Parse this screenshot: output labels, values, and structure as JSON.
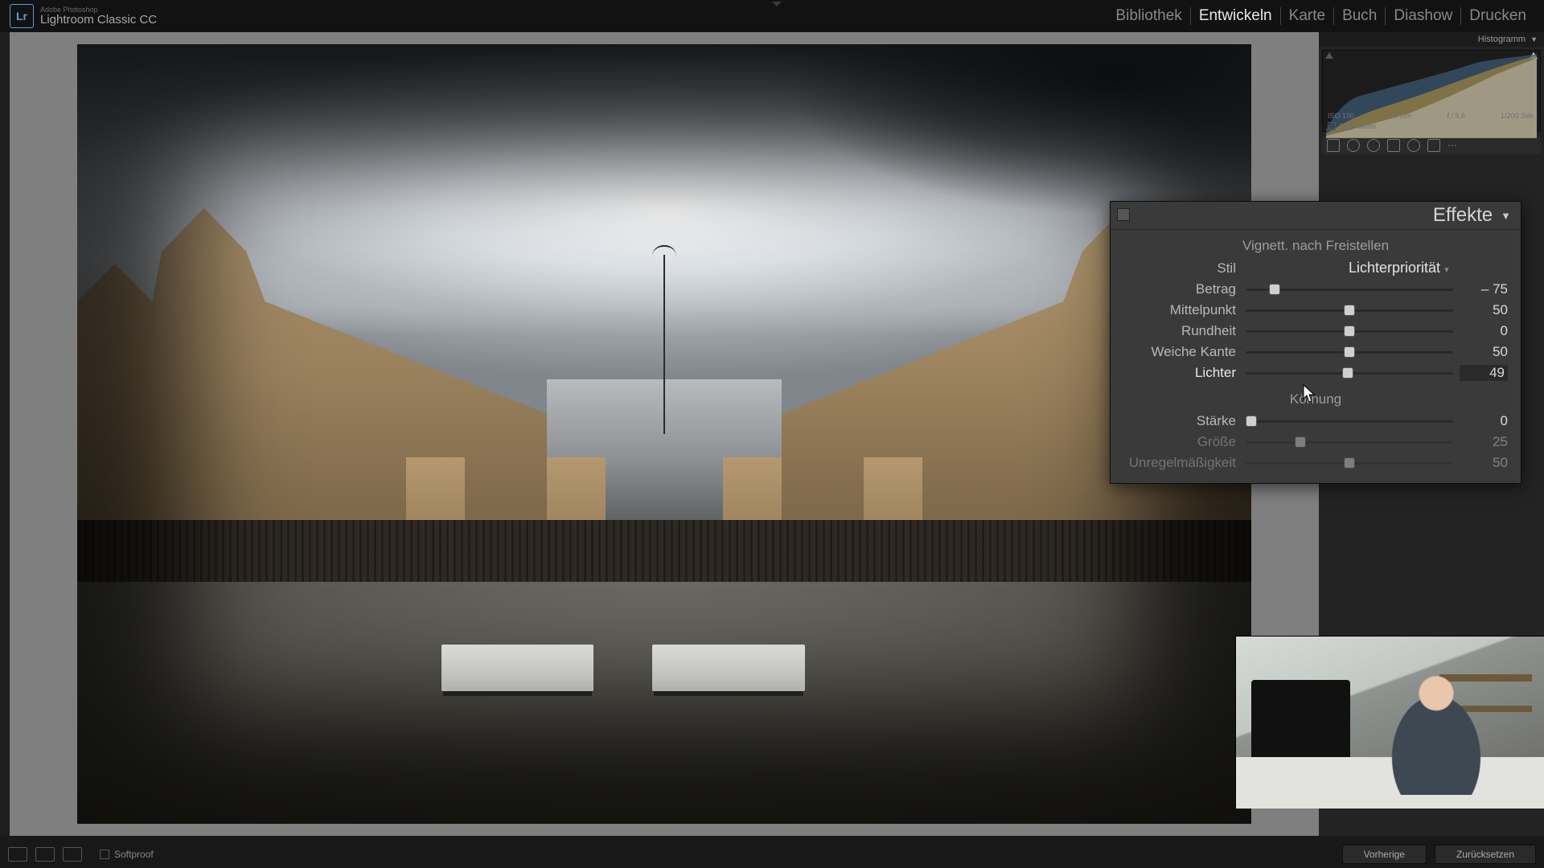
{
  "app": {
    "vendor": "Adobe Photoshop",
    "name": "Lightroom Classic CC",
    "logo_text": "Lr"
  },
  "modules": {
    "library": "Bibliothek",
    "develop": "Entwickeln",
    "map": "Karte",
    "book": "Buch",
    "slideshow": "Diashow",
    "print": "Drucken"
  },
  "histogram": {
    "title": "Histogramm",
    "iso": "ISO 100",
    "focal": "16 mm",
    "aperture": "f / 5,6",
    "shutter": "1/200 Sek.",
    "original_label": "Originalfoto"
  },
  "effects_panel": {
    "title": "Effekte",
    "vignette_section": "Vignett. nach Freistellen",
    "style_label": "Stil",
    "style_value": "Lichterpriorität",
    "amount": {
      "label": "Betrag",
      "value": "– 75",
      "pos_pct": 12
    },
    "midpoint": {
      "label": "Mittelpunkt",
      "value": "50",
      "pos_pct": 50
    },
    "roundness": {
      "label": "Rundheit",
      "value": "0",
      "pos_pct": 50
    },
    "feather": {
      "label": "Weiche Kante",
      "value": "50",
      "pos_pct": 50
    },
    "highlights": {
      "label": "Lichter",
      "value": "49",
      "pos_pct": 49
    },
    "grain_section": "Körnung",
    "grain_amount": {
      "label": "Stärke",
      "value": "0",
      "pos_pct": 0
    },
    "grain_size": {
      "label": "Größe",
      "value": "25",
      "pos_pct": 25
    },
    "grain_roughness": {
      "label": "Unregelmäßigkeit",
      "value": "50",
      "pos_pct": 50
    }
  },
  "bottombar": {
    "softproof": "Softproof",
    "previous": "Vorherige",
    "reset": "Zurücksetzen"
  }
}
